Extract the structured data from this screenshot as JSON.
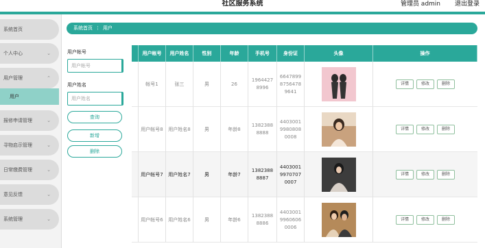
{
  "header": {
    "title": "社区服务系统",
    "user": "管理员 admin",
    "logout": "退出登录"
  },
  "sidebar": {
    "items": [
      {
        "label": "系统首页"
      },
      {
        "label": "个人中心"
      },
      {
        "label": "用户管理"
      },
      {
        "label": "报修申请管理"
      },
      {
        "label": "寻物启示管理"
      },
      {
        "label": "日常缴费管理"
      },
      {
        "label": "意见反馈"
      },
      {
        "label": "系统管理"
      }
    ],
    "sub_active": "用户"
  },
  "breadcrumb": {
    "home": "系统首页",
    "sep": "⋮",
    "current": "用户"
  },
  "search": {
    "account_label": "用户帐号",
    "account_placeholder": "用户帐号",
    "name_label": "用户姓名",
    "name_placeholder": "用户姓名",
    "query": "查询",
    "add": "新增",
    "delete": "删除"
  },
  "table": {
    "headers": [
      "用户帐号",
      "用户姓名",
      "性别",
      "年龄",
      "手机号",
      "身份证",
      "头像",
      "操作"
    ],
    "rows": [
      {
        "account": "帐号1",
        "name": "张三",
        "gender": "男",
        "age": "26",
        "phone": "19644278996",
        "idcard": "664789987564789641"
      },
      {
        "account": "用户帐号8",
        "name": "用户姓名8",
        "gender": "男",
        "age": "年龄8",
        "phone": "13823888888",
        "idcard": "440300199808080008"
      },
      {
        "account": "用户帐号7",
        "name": "用户姓名7",
        "gender": "男",
        "age": "年龄7",
        "phone": "13823888887",
        "idcard": "440300199707070007"
      },
      {
        "account": "用户帐号6",
        "name": "用户姓名6",
        "gender": "男",
        "age": "年龄6",
        "phone": "13823888886",
        "idcard": "440300199606060006"
      }
    ],
    "actions": {
      "detail": "详情",
      "edit": "修改",
      "delete": "删除"
    }
  }
}
